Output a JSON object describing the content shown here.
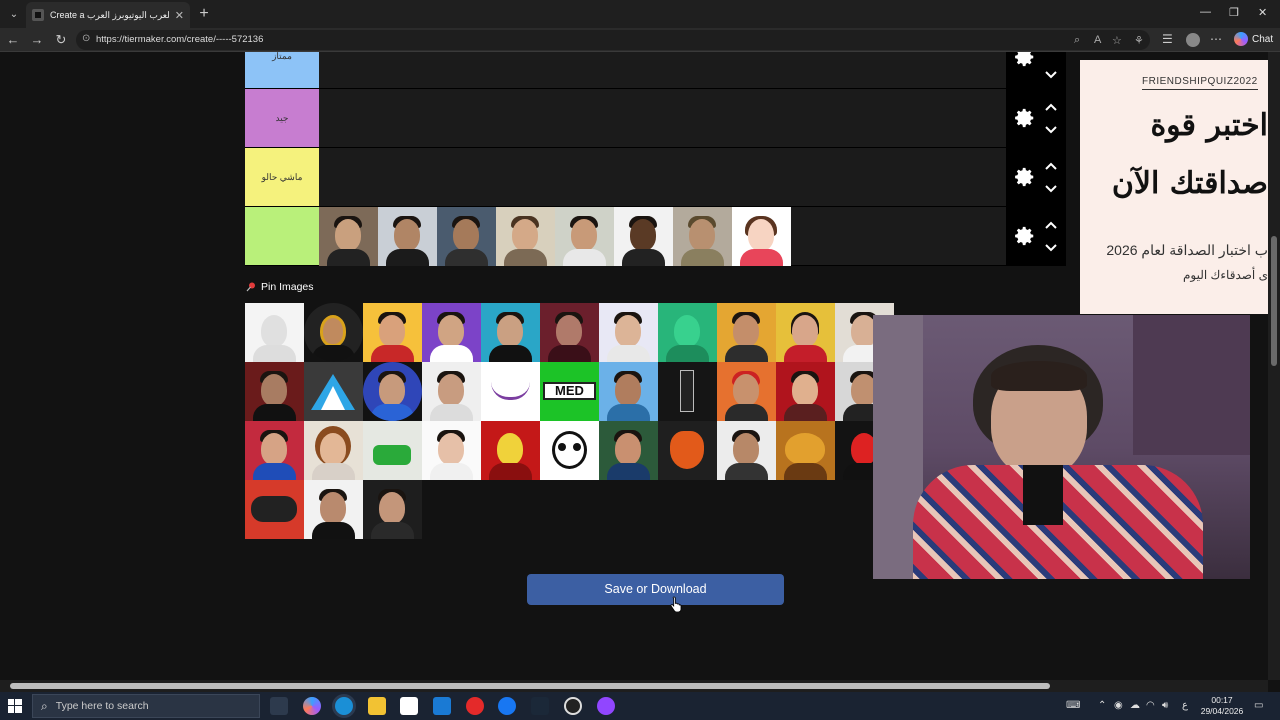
{
  "browser": {
    "tab_title": "Create a تاير ليست اليوتيوبرز العرب اليوتيوبرز العرب",
    "url": "https://tiermaker.com/create/-----572136",
    "copilot_label": "Chat"
  },
  "tiers": [
    {
      "label": "ممتاز",
      "color": "#8dc3f7"
    },
    {
      "label": "جيد",
      "color": "#c77dd0"
    },
    {
      "label": "ماشي حالو",
      "color": "#f5f27d"
    },
    {
      "label": "",
      "color": "#b9f07a"
    }
  ],
  "pin_images_label": "Pin Images",
  "save_button_label": "Save or Download",
  "ad": {
    "brand": "FRIENDSHIPQUIZ2022",
    "headline_1": "اختبر قوة",
    "headline_2": "صداقتك الآن",
    "line_1": "ب اختبار الصداقة لعام 2026",
    "line_2": "ى أصدقاءك اليوم"
  },
  "taskbar": {
    "search_placeholder": "Type here to search",
    "time": "00:17",
    "date": "29/04/2026"
  },
  "colors": {
    "accent_button": "#3c5fa3",
    "page_bg": "#121212"
  }
}
